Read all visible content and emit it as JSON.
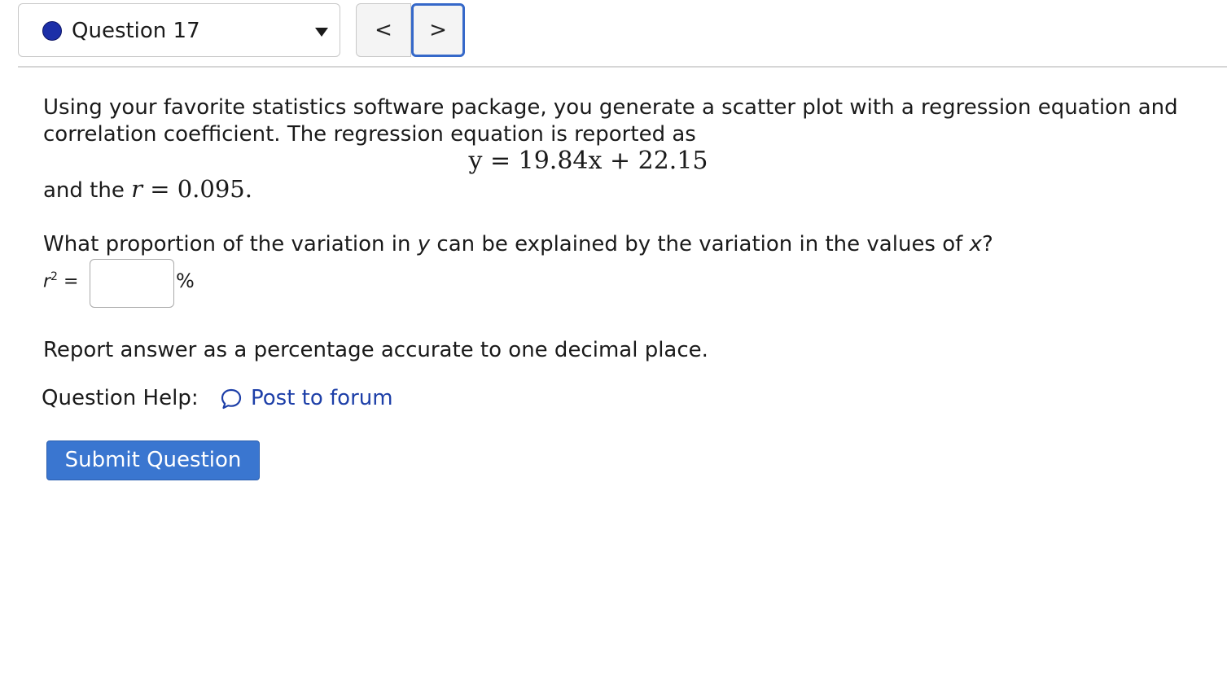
{
  "question_selector": {
    "label": "Question 17",
    "status_color": "#1c2fa8"
  },
  "navigation": {
    "prev_label": "<",
    "next_label": ">"
  },
  "question": {
    "intro": "Using your favorite statistics software package, you generate a scatter plot with a regression equation and correlation coefficient. The regression equation is reported as",
    "equation": "y = 19.84x + 22.15",
    "r_prefix": "and the ",
    "r_var": "r",
    "r_value": " = 0.095.",
    "prompt_part1": "What proportion of the variation in ",
    "prompt_var_y": "y",
    "prompt_part2": " can be explained by the variation in the values of ",
    "prompt_var_x": "x",
    "prompt_part3": "?",
    "answer_label": "r",
    "answer_label_sup": "2",
    "answer_label_eq": " =",
    "answer_value": "",
    "answer_unit": "%",
    "instruction": "Report answer as a percentage accurate to one decimal place."
  },
  "help": {
    "label": "Question Help:",
    "forum_icon": "speech-bubble-icon",
    "forum_link": "Post to forum",
    "link_color": "#1d3fa8"
  },
  "submit": {
    "label": "Submit Question",
    "color": "#3a76d0"
  }
}
